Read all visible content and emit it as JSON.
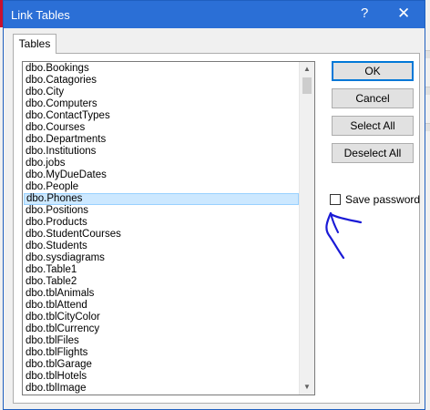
{
  "window": {
    "title": "Link Tables",
    "help_glyph": "?",
    "close_glyph": "✕"
  },
  "tabs": [
    {
      "label": "Tables"
    }
  ],
  "tables": [
    "dbo.Bookings",
    "dbo.Catagories",
    "dbo.City",
    "dbo.Computers",
    "dbo.ContactTypes",
    "dbo.Courses",
    "dbo.Departments",
    "dbo.Institutions",
    "dbo.jobs",
    "dbo.MyDueDates",
    "dbo.People",
    "dbo.Phones",
    "dbo.Positions",
    "dbo.Products",
    "dbo.StudentCourses",
    "dbo.Students",
    "dbo.sysdiagrams",
    "dbo.Table1",
    "dbo.Table2",
    "dbo.tblAnimals",
    "dbo.tblAttend",
    "dbo.tblCityColor",
    "dbo.tblCurrency",
    "dbo.tblFiles",
    "dbo.tblFlights",
    "dbo.tblGarage",
    "dbo.tblHotels",
    "dbo.tblImage"
  ],
  "selected_table": "dbo.Phones",
  "buttons": {
    "ok": "OK",
    "cancel": "Cancel",
    "select_all": "Select All",
    "deselect_all": "Deselect All"
  },
  "save_password": {
    "label": "Save password",
    "checked": false
  },
  "colors": {
    "titlebar": "#2b6fd6",
    "selection": "#cce8ff",
    "annotation": "#1a1ad6"
  }
}
